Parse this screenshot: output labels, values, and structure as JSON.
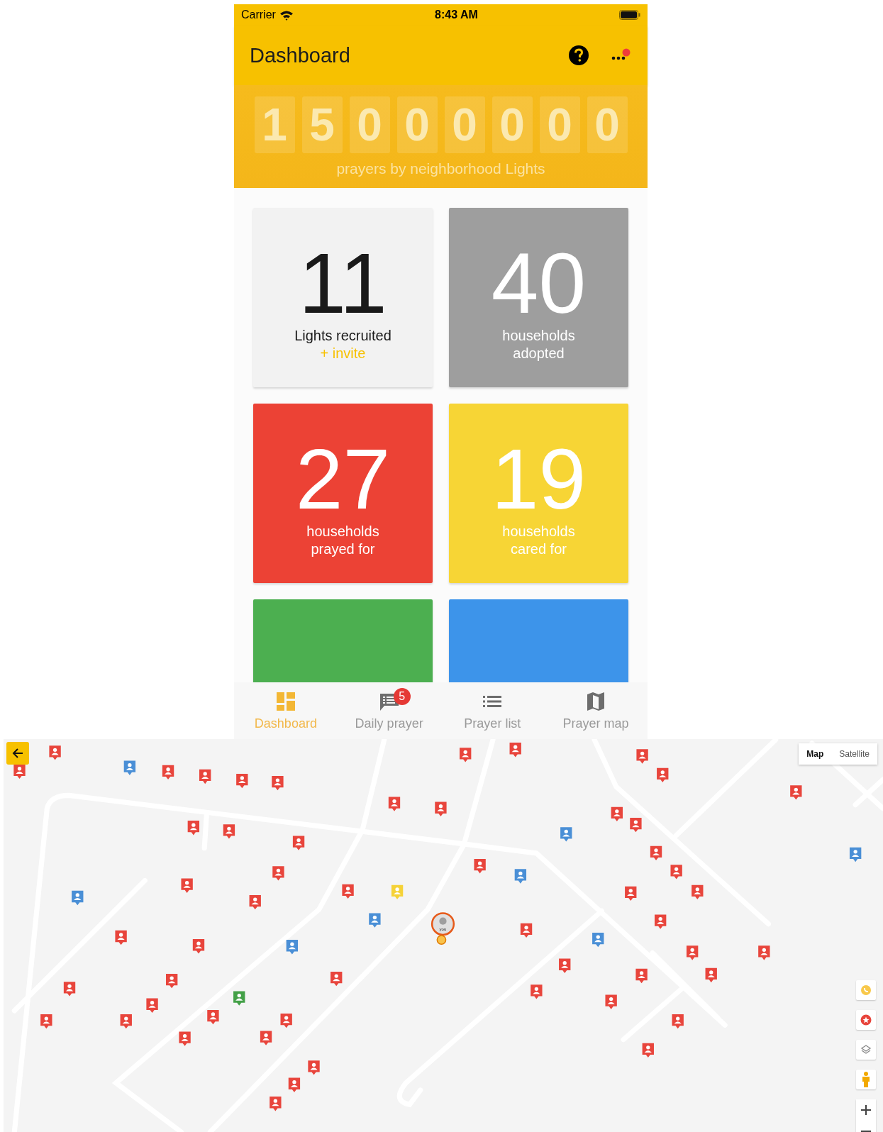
{
  "status_bar": {
    "carrier": "Carrier",
    "time": "8:43 AM"
  },
  "header": {
    "title": "Dashboard",
    "notification": true
  },
  "counter": {
    "digits": [
      "1",
      "5",
      "0",
      "0",
      "0",
      "0",
      "0",
      "0"
    ],
    "caption": "prayers by neighborhood Lights"
  },
  "tiles": [
    {
      "number": "11",
      "lines": [
        "Lights recruited"
      ],
      "link": "+ invite",
      "color": "#f2f2f2"
    },
    {
      "number": "40",
      "lines": [
        "households",
        "adopted"
      ],
      "color": "#9e9e9e"
    },
    {
      "number": "27",
      "lines": [
        "households",
        "prayed for"
      ],
      "color": "#ec4235"
    },
    {
      "number": "19",
      "lines": [
        "households",
        "cared for"
      ],
      "color": "#f7d535"
    },
    {
      "color": "#4caf50"
    },
    {
      "color": "#3d94ea"
    }
  ],
  "tabs": [
    {
      "label": "Dashboard",
      "selected": true,
      "kind": "grid"
    },
    {
      "label": "Daily prayer",
      "selected": false,
      "kind": "chat",
      "badge": "5"
    },
    {
      "label": "Prayer list",
      "selected": false,
      "kind": "list"
    },
    {
      "label": "Prayer map",
      "selected": false,
      "kind": "map"
    }
  ],
  "map": {
    "types": [
      {
        "label": "Map",
        "selected": true
      },
      {
        "label": "Satellite",
        "selected": false
      }
    ],
    "you_label": "you",
    "markers": [
      {
        "color": "#e8453c"
      },
      {
        "color": "#e8453c"
      },
      {
        "color": "#4a8fd6"
      },
      {
        "color": "#e8453c"
      },
      {
        "color": "#e8453c"
      },
      {
        "color": "#e8453c"
      },
      {
        "color": "#e8453c"
      },
      {
        "color": "#e8453c"
      },
      {
        "color": "#e8453c"
      },
      {
        "color": "#e8453c"
      },
      {
        "color": "#e8453c"
      },
      {
        "color": "#e8453c"
      },
      {
        "color": "#e8453c"
      },
      {
        "color": "#e8453c"
      },
      {
        "color": "#e8453c"
      },
      {
        "color": "#e8453c"
      },
      {
        "color": "#e8453c"
      },
      {
        "color": "#e8453c"
      },
      {
        "color": "#e8453c"
      },
      {
        "color": "#4a8fd6"
      },
      {
        "color": "#e8453c"
      },
      {
        "color": "#4a8fd6"
      },
      {
        "color": "#e8453c"
      },
      {
        "color": "#e8453c"
      },
      {
        "color": "#4a8fd6"
      },
      {
        "color": "#e8453c"
      },
      {
        "color": "#e8453c"
      },
      {
        "color": "#4a8fd6"
      },
      {
        "color": "#e8453c"
      },
      {
        "color": "#e8453c"
      },
      {
        "color": "#f5d237"
      },
      {
        "color": "#e8453c"
      },
      {
        "color": "#e8453c"
      },
      {
        "color": "#e8453c"
      },
      {
        "color": "#4a8fd6"
      },
      {
        "color": "#e8453c"
      },
      {
        "color": "#e8453c"
      },
      {
        "color": "#e8453c"
      },
      {
        "color": "#4a8fd6"
      },
      {
        "color": "#4a8fd6"
      },
      {
        "color": "#e8453c"
      },
      {
        "color": "#e8453c"
      },
      {
        "color": "#e8453c"
      },
      {
        "color": "#e8453c"
      },
      {
        "color": "#e8453c"
      },
      {
        "color": "#e8453c"
      },
      {
        "color": "#e8453c"
      },
      {
        "color": "#e8453c"
      },
      {
        "color": "#e8453c"
      },
      {
        "color": "#e8453c"
      },
      {
        "color": "#43a047"
      },
      {
        "color": "#e8453c"
      },
      {
        "color": "#e8453c"
      },
      {
        "color": "#e8453c"
      },
      {
        "color": "#e8453c"
      },
      {
        "color": "#e8453c"
      },
      {
        "color": "#e8453c"
      },
      {
        "color": "#e8453c"
      },
      {
        "color": "#e8453c"
      },
      {
        "color": "#e8453c"
      },
      {
        "color": "#e8453c"
      },
      {
        "color": "#e8453c"
      },
      {
        "color": "#e8453c"
      }
    ]
  }
}
